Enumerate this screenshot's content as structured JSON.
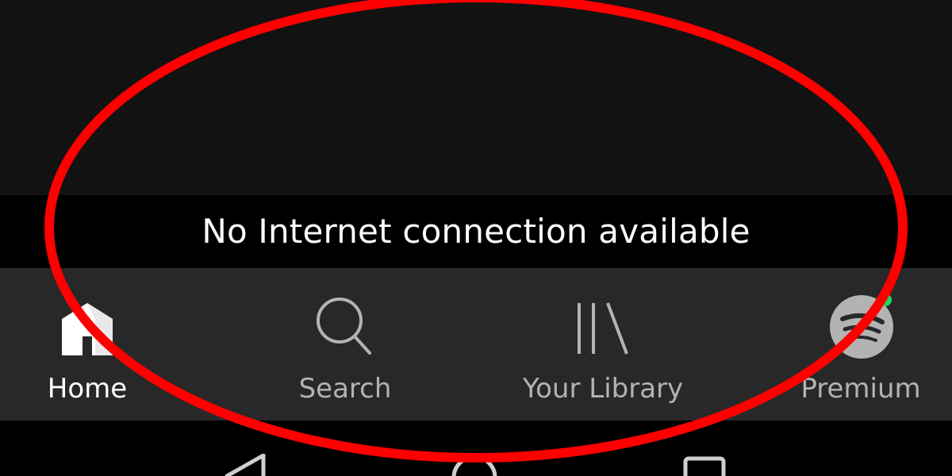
{
  "offline_banner": {
    "message": "No Internet connection available"
  },
  "bottom_nav": {
    "items": [
      {
        "label": "Home",
        "icon": "home-icon",
        "active": true,
        "color": "#ffffff"
      },
      {
        "label": "Search",
        "icon": "search-icon",
        "active": false,
        "color": "#b3b3b3"
      },
      {
        "label": "Your Library",
        "icon": "library-icon",
        "active": false,
        "color": "#b3b3b3"
      },
      {
        "label": "Premium",
        "icon": "spotify-logo-icon",
        "active": false,
        "color": "#b3b3b3"
      }
    ]
  },
  "system_nav": {
    "buttons": [
      "back-icon",
      "home-circle-icon",
      "recents-icon"
    ]
  },
  "colors": {
    "background": "#121212",
    "banner": "#000000",
    "nav_bar": "#282828",
    "active": "#ffffff",
    "inactive": "#b3b3b3",
    "notification_dot": "#1ed760",
    "annotation": "#ff0000"
  }
}
